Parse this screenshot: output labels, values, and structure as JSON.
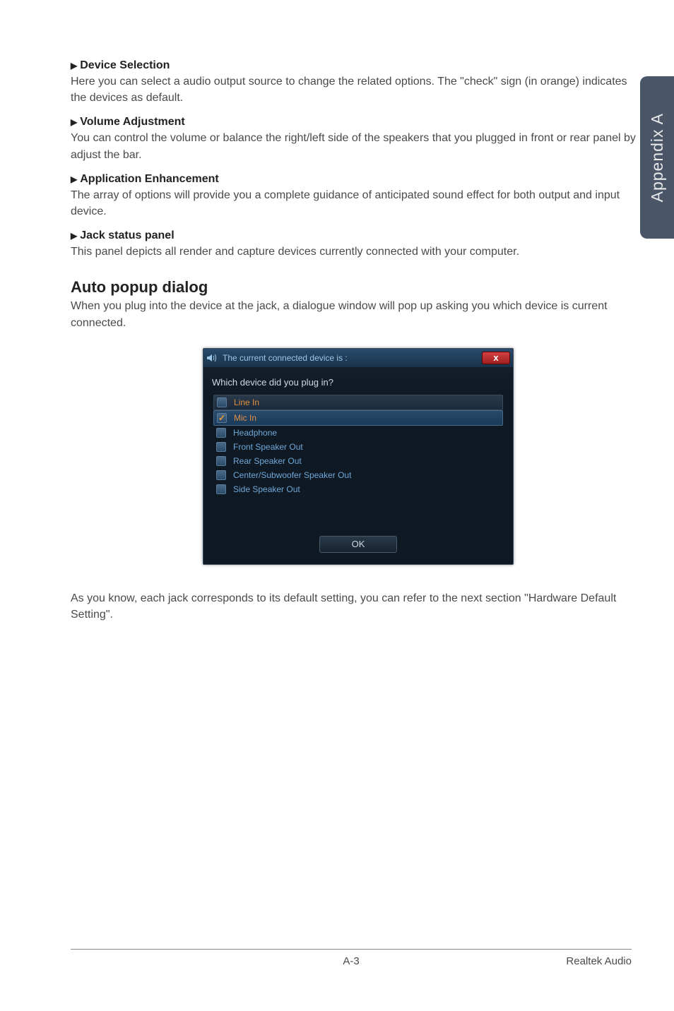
{
  "sideTab": "Appendix A",
  "sections": {
    "deviceSelection": {
      "title": "Device Selection",
      "body": "Here you can select a audio output source to change the related options. The \"check\" sign (in orange) indicates the devices as default."
    },
    "volumeAdjustment": {
      "title": "Volume Adjustment",
      "body": "You can control the volume or balance the right/left side of the speakers that you plugged in front or rear panel by adjust the bar."
    },
    "applicationEnhancement": {
      "title": "Application Enhancement",
      "body": "The array of options will provide you a complete guidance of anticipated sound effect for both output and input device."
    },
    "jackStatusPanel": {
      "title": "Jack status panel",
      "body": "This panel depicts all render and capture devices currently connected with your computer."
    }
  },
  "autoPopup": {
    "heading": "Auto popup dialog",
    "intro": "When you plug into the device at the jack, a dialogue window will pop up asking you which device is current connected."
  },
  "dialog": {
    "title": "The current connected device is :",
    "prompt": "Which device did you plug in?",
    "closeLabel": "x",
    "items": {
      "0": {
        "label": "Line In"
      },
      "1": {
        "label": "Mic In",
        "check": "✓"
      },
      "2": {
        "label": "Headphone"
      },
      "3": {
        "label": "Front Speaker Out"
      },
      "4": {
        "label": "Rear Speaker Out"
      },
      "5": {
        "label": "Center/Subwoofer Speaker Out"
      },
      "6": {
        "label": "Side Speaker Out"
      }
    },
    "okLabel": "OK"
  },
  "afterDialog": "As you know, each jack corresponds to its default setting, you can refer to the next section \"Hardware Default Setting\".",
  "footer": {
    "page": "A-3",
    "section": "Realtek Audio"
  }
}
